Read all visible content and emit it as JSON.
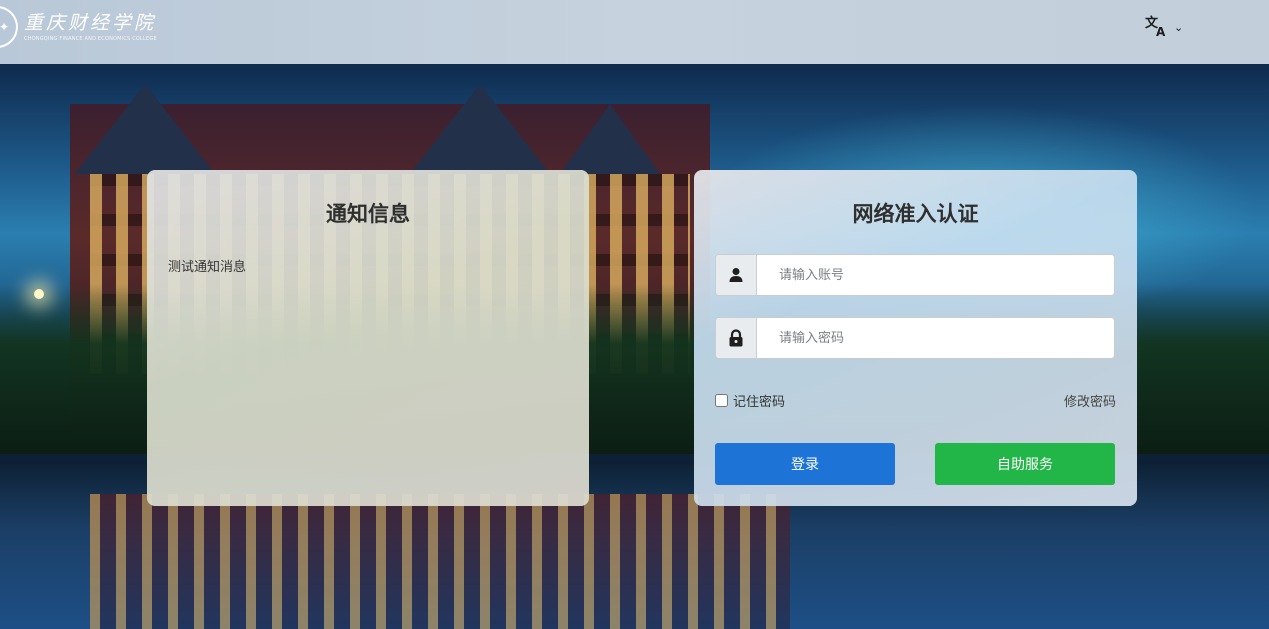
{
  "header": {
    "logo_cn": "重庆财经学院",
    "logo_en": "CHONGQING FINANCE AND ECONOMICS COLLEGE",
    "language_icon": "translate-icon",
    "language_chevron": "⌄"
  },
  "notice": {
    "title": "通知信息",
    "message": "测试通知消息"
  },
  "login": {
    "title": "网络准入认证",
    "account_placeholder": "请输入账号",
    "account_value": "",
    "account_icon": "user-icon",
    "password_placeholder": "请输入密码",
    "password_value": "",
    "password_icon": "lock-icon",
    "remember_label": "记住密码",
    "remember_checked": false,
    "change_password_label": "修改密码",
    "login_button": "登录",
    "self_service_button": "自助服务"
  },
  "colors": {
    "login_button": "#1d74d6",
    "self_service_button": "#22b548",
    "header_bg": "#c2cfdb"
  }
}
